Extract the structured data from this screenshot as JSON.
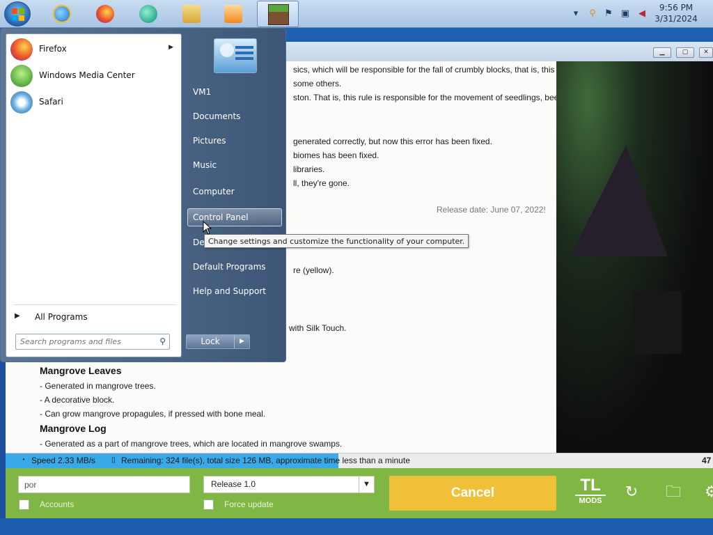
{
  "taskbar": {
    "clock_time": "9:56 PM",
    "clock_date": "3/31/2024",
    "pinned": [
      "windows-start",
      "internet-explorer",
      "firefox",
      "media-app",
      "file-explorer",
      "media-player",
      "minecraft-launcher"
    ]
  },
  "start_menu": {
    "programs": [
      {
        "label": "Firefox",
        "icon": "firefox-icon",
        "has_submenu": true
      },
      {
        "label": "Windows Media Center",
        "icon": "windows-media-center-icon",
        "has_submenu": false
      },
      {
        "label": "Safari",
        "icon": "safari-icon",
        "has_submenu": false
      }
    ],
    "all_programs": "All Programs",
    "search_placeholder": "Search programs and files",
    "right_items": [
      "VM1",
      "Documents",
      "Pictures",
      "Music",
      "Computer",
      "Control Panel",
      "Devices and Printers",
      "Default Programs",
      "Help and Support"
    ],
    "right_items_visible": [
      "VM1",
      "Documents",
      "Pictures",
      "Music",
      "Computer",
      "Control Panel",
      "Dev",
      "Default Programs",
      "Help and Support"
    ],
    "hovered_item": "Control Panel",
    "lock_label": "Lock",
    "tooltip": "Change settings and customize the functionality of your computer."
  },
  "article": {
    "lines": [
      "sics, which will be responsible for the fall of crumbly blocks, that is, this",
      "some others.",
      "ston. That is, this rule is responsible for the movement of seedlings, bee",
      "generated correctly, but now this error has been fixed.",
      "biomes has been fixed.",
      "libraries.",
      "ll, they're gone.",
      "re (yellow).",
      "with Silk Touch."
    ],
    "release_date": "Release date: June 07, 2022!",
    "section1_title": "Mangrove Leaves",
    "section1_items": [
      "- Generated in mangrove trees.",
      "- A decorative block.",
      "- Can grow mangrove propagules, if pressed with bone meal."
    ],
    "section2_title": "Mangrove Log",
    "section2_items": [
      "- Generated as a part of mangrove trees, which are located in mangrove swamps."
    ]
  },
  "status": {
    "speed": "Speed 2.33 MB/s",
    "remaining": "Remaining: 324 file(s), total size 126 MB, approximate time less than a minute",
    "percent_label": "47",
    "progress_fraction": 0.47
  },
  "launcher": {
    "nickname_value": "por",
    "version_value": "Release 1.0",
    "accounts_label": "Accounts",
    "force_update_label": "Force update",
    "cancel_label": "Cancel",
    "logo_top": "TL",
    "logo_bottom": "MODS",
    "accent_color": "#80b744",
    "cancel_color": "#f0c038"
  }
}
